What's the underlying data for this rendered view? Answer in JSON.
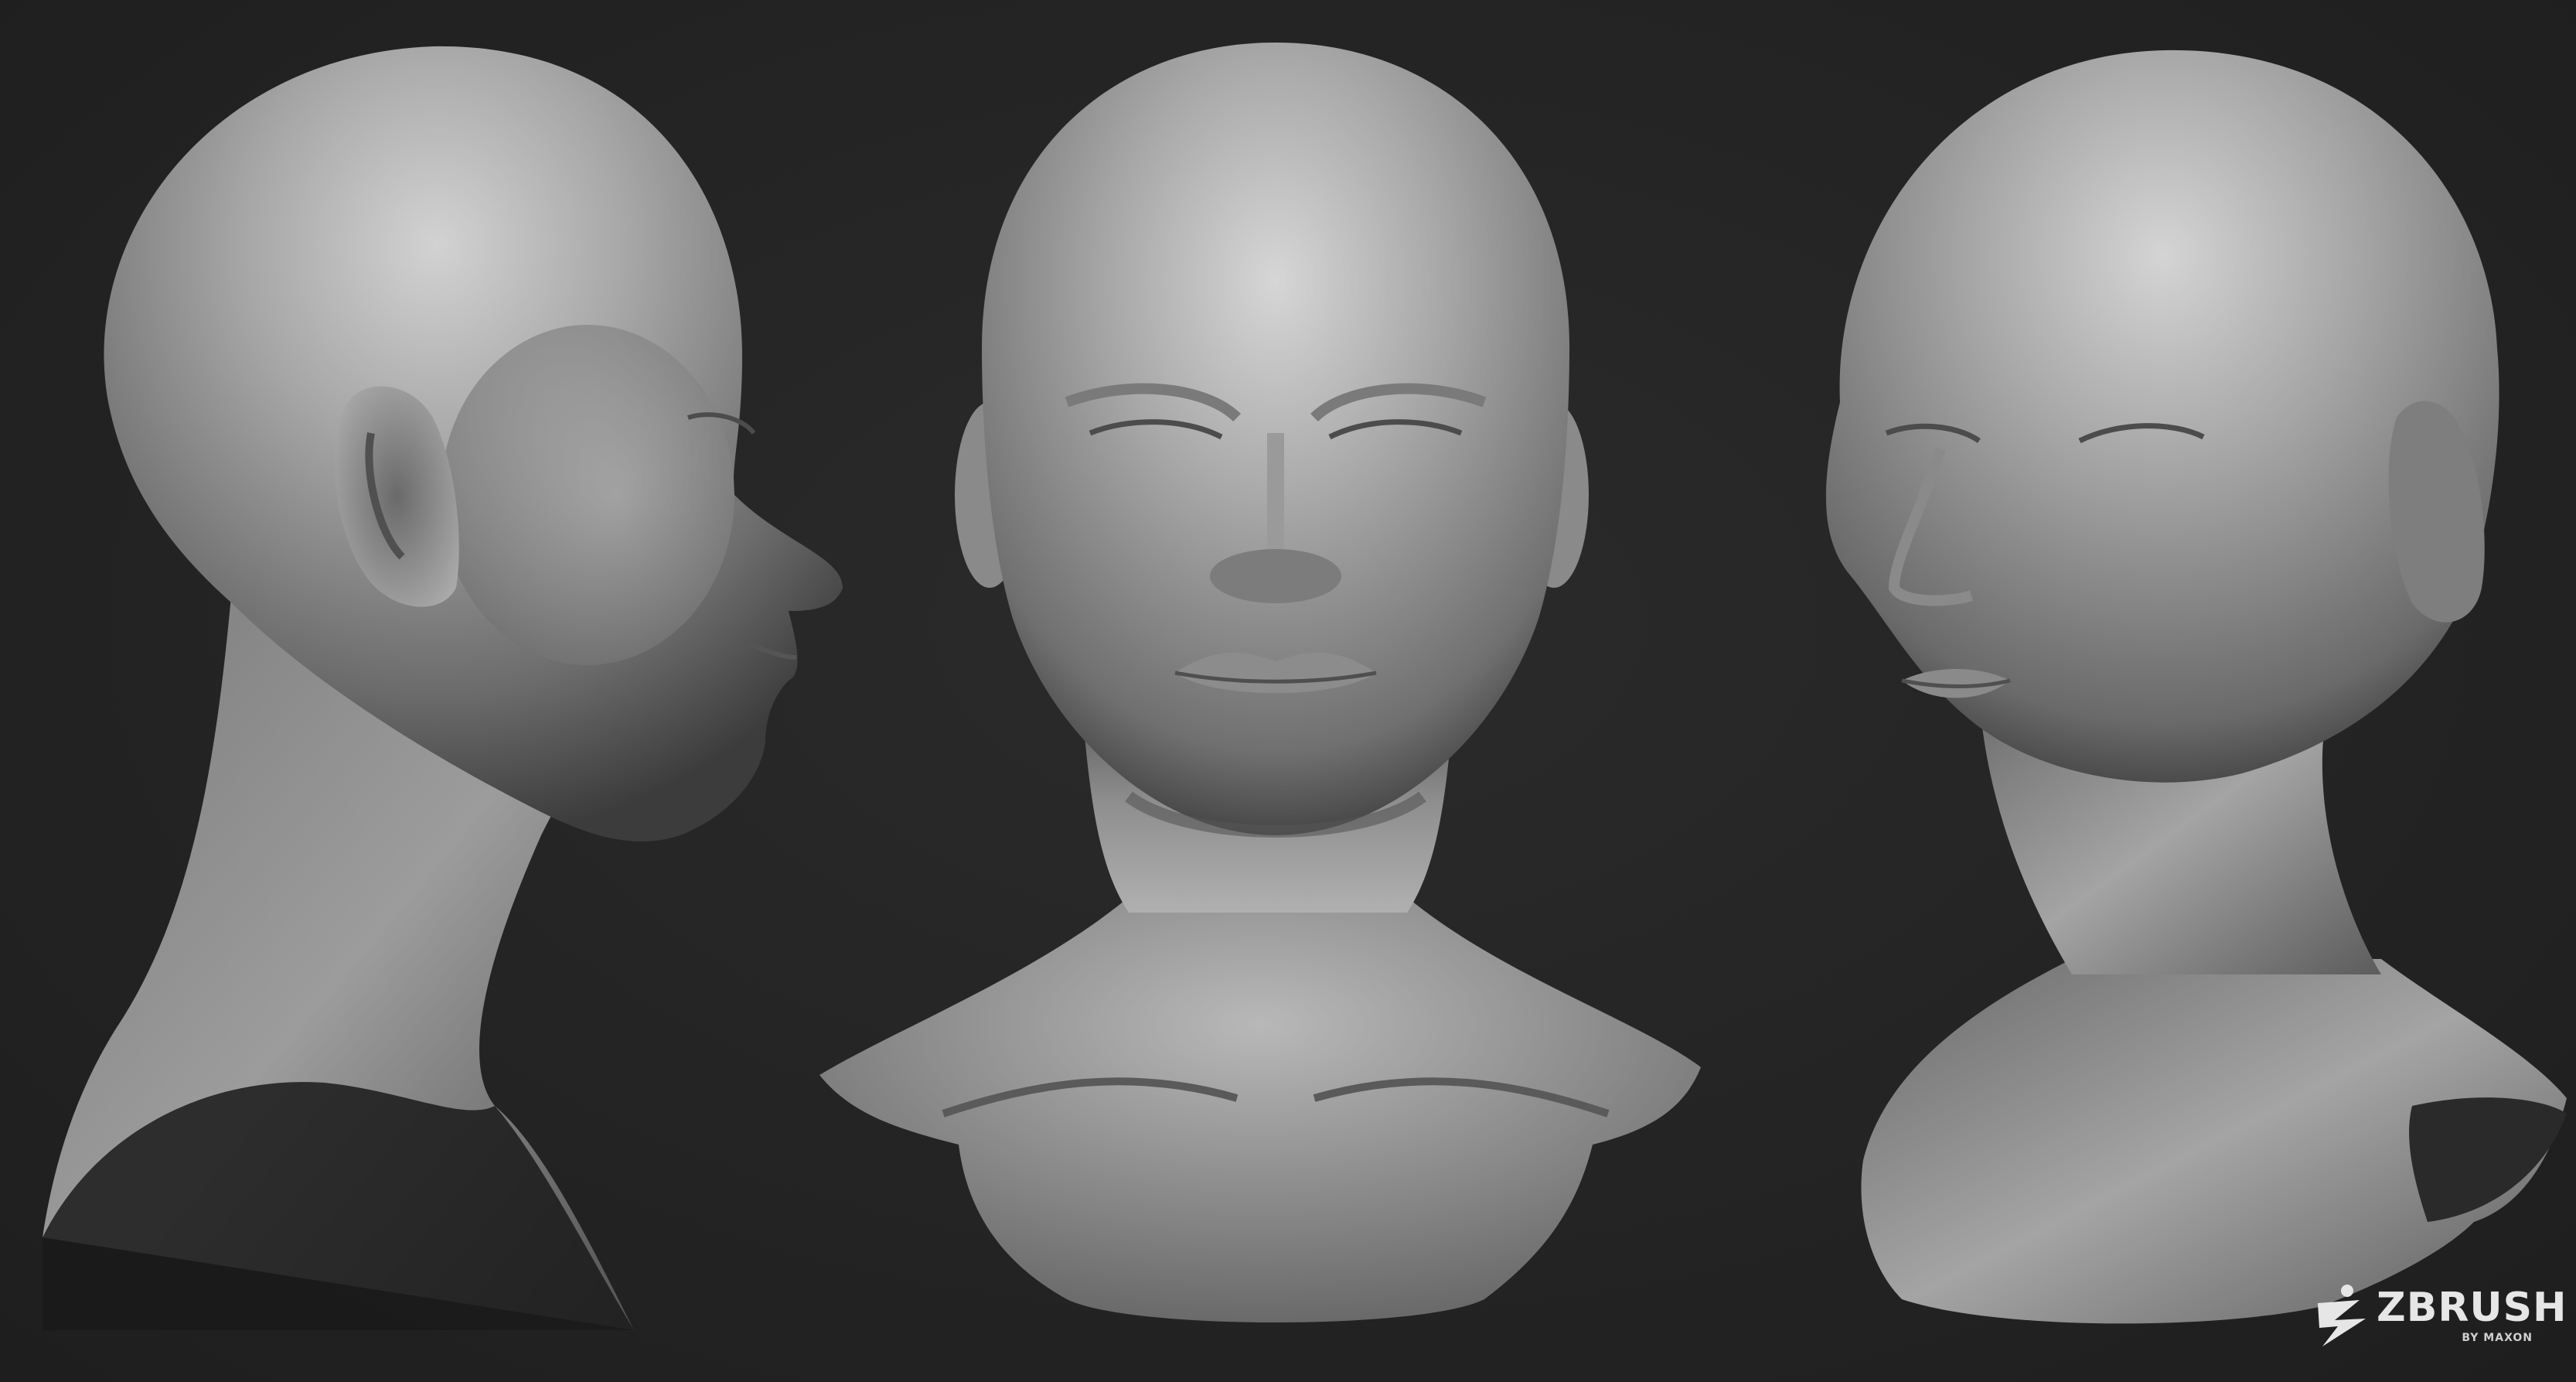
{
  "scene": {
    "background_color": "#242424",
    "subject_color": "#9a9a9a",
    "views": [
      "left-profile",
      "front",
      "three-quarter-right"
    ]
  },
  "logo": {
    "brand": "ZBRUSH",
    "byline": "BY MAXON",
    "color": "#e6e6e6"
  }
}
